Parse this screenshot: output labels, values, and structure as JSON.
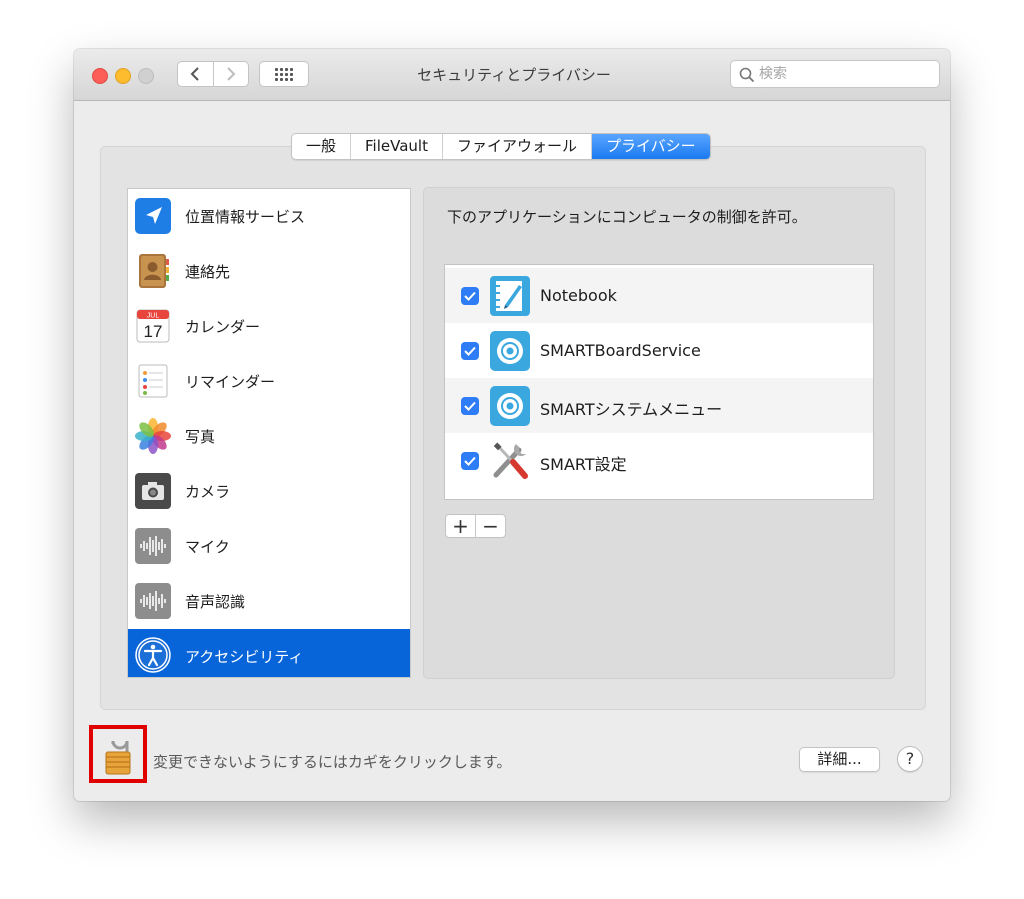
{
  "window": {
    "title": "セキュリティとプライバシー",
    "search_placeholder": "検索"
  },
  "tabs": [
    {
      "label": "一般",
      "active": false
    },
    {
      "label": "FileVault",
      "active": false
    },
    {
      "label": "ファイアウォール",
      "active": false
    },
    {
      "label": "プライバシー",
      "active": true
    }
  ],
  "sidebar": {
    "items": [
      {
        "label": "位置情報サービス",
        "icon": "location-arrow-icon"
      },
      {
        "label": "連絡先",
        "icon": "contacts-book-icon"
      },
      {
        "label": "カレンダー",
        "icon": "calendar-icon",
        "icon_text": {
          "month": "JUL",
          "day": "17"
        }
      },
      {
        "label": "リマインダー",
        "icon": "reminders-icon"
      },
      {
        "label": "写真",
        "icon": "photos-icon"
      },
      {
        "label": "カメラ",
        "icon": "camera-icon"
      },
      {
        "label": "マイク",
        "icon": "microphone-waveform-icon"
      },
      {
        "label": "音声認識",
        "icon": "speech-recognition-icon"
      },
      {
        "label": "アクセシビリティ",
        "icon": "accessibility-icon",
        "selected": true
      }
    ]
  },
  "main": {
    "instruction": "下のアプリケーションにコンピュータの制御を許可。",
    "apps": [
      {
        "label": "Notebook",
        "checked": true,
        "icon": "notebook-app-icon"
      },
      {
        "label": "SMARTBoardService",
        "checked": true,
        "icon": "smart-board-service-icon"
      },
      {
        "label": "SMARTシステムメニュー",
        "checked": true,
        "icon": "smart-system-menu-icon"
      },
      {
        "label": "SMART設定",
        "checked": true,
        "icon": "tools-settings-icon"
      }
    ],
    "add_label": "+",
    "remove_label": "−"
  },
  "footer": {
    "lock_text": "変更できないようにするにはカギをクリックします。",
    "advanced_label": "詳細...",
    "help_label": "?",
    "lock_state": "unlocked"
  },
  "colors": {
    "accent": "#0764d9",
    "tab_active": "#1a7af0",
    "checkbox": "#2e7cf6",
    "highlight_box": "#e10000"
  }
}
